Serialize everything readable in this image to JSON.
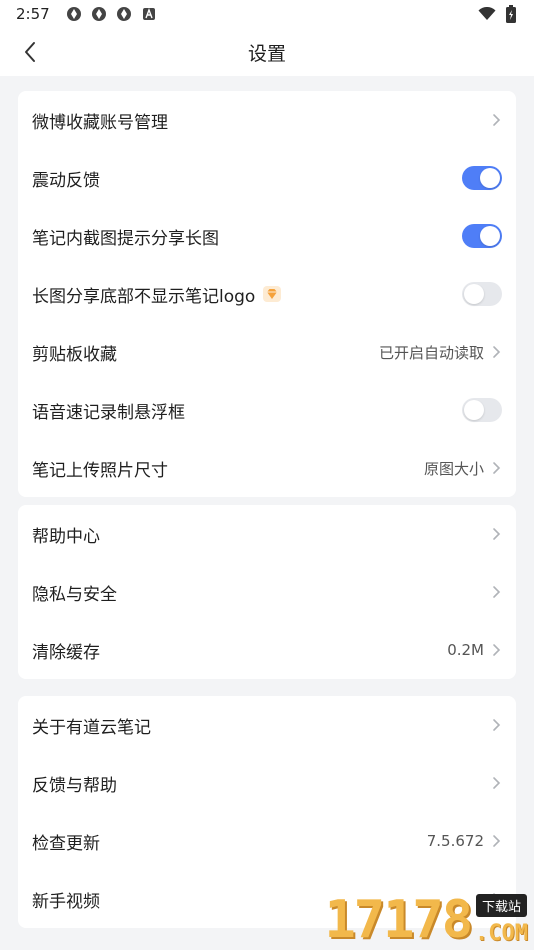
{
  "status_bar": {
    "time": "2:57"
  },
  "header": {
    "title": "设置"
  },
  "group1": [
    {
      "label": "微博收藏账号管理",
      "kind": "link"
    },
    {
      "label": "震动反馈",
      "kind": "toggle",
      "on": true
    },
    {
      "label": "笔记内截图提示分享长图",
      "kind": "toggle",
      "on": true
    },
    {
      "label": "长图分享底部不显示笔记logo",
      "kind": "toggle",
      "on": false,
      "vip": true
    },
    {
      "label": "剪贴板收藏",
      "kind": "link",
      "value": "已开启自动读取"
    },
    {
      "label": "语音速记录制悬浮框",
      "kind": "toggle",
      "on": false
    },
    {
      "label": "笔记上传照片尺寸",
      "kind": "link",
      "value": "原图大小"
    }
  ],
  "group2": [
    {
      "label": "帮助中心",
      "kind": "link"
    },
    {
      "label": "隐私与安全",
      "kind": "link"
    },
    {
      "label": "清除缓存",
      "kind": "link",
      "value": "0.2M"
    }
  ],
  "group3": [
    {
      "label": "关于有道云笔记",
      "kind": "link"
    },
    {
      "label": "反馈与帮助",
      "kind": "link"
    },
    {
      "label": "检查更新",
      "kind": "link",
      "value": "7.5.672"
    },
    {
      "label": "新手视频",
      "kind": "link"
    }
  ],
  "watermark": {
    "digits": "17178",
    "badge": "下载站",
    "suffix": ".COM"
  },
  "colors": {
    "accent": "#4f7ef7",
    "vip": "#f5a23c"
  }
}
